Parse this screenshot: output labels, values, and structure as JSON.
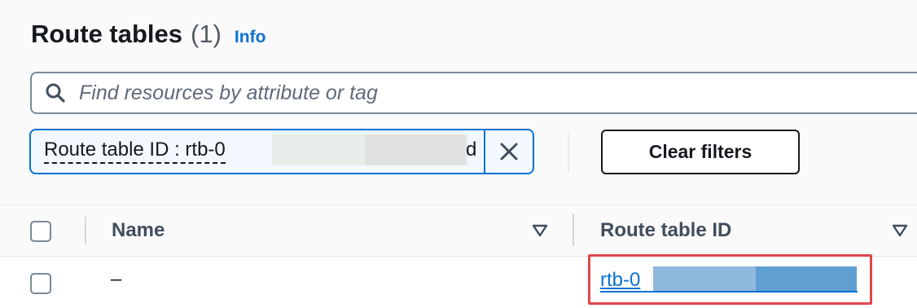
{
  "header": {
    "title": "Route tables",
    "count": "(1)",
    "info_link": "Info"
  },
  "search": {
    "placeholder": "Find resources by attribute or tag"
  },
  "filter_token": {
    "label": "Route table ID : rtb-0",
    "trailing_char": "d"
  },
  "buttons": {
    "clear_filters": "Clear filters"
  },
  "table": {
    "columns": [
      "Name",
      "Route table ID"
    ],
    "rows": [
      {
        "name": "–",
        "route_table_id": "rtb-0"
      }
    ]
  },
  "colors": {
    "link": "#0972d3",
    "highlight": "#e0474c",
    "token_border": "#0972d3"
  }
}
